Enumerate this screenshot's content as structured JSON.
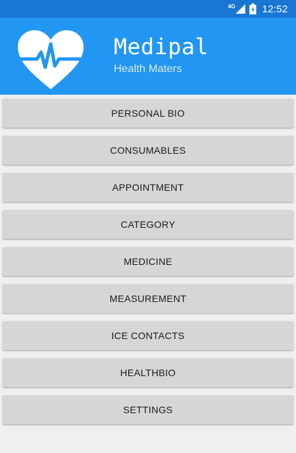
{
  "status_bar": {
    "network_label": "4G",
    "time": "12:52",
    "signal_icon": "signal-icon",
    "battery_icon": "battery-icon"
  },
  "header": {
    "title": "Medipal",
    "subtitle": "Health Maters",
    "logo_icon": "heart-pulse-icon",
    "background_color": "#2196f3",
    "status_bar_color": "#1976d2"
  },
  "menu": {
    "items": [
      {
        "label": "PERSONAL BIO"
      },
      {
        "label": "CONSUMABLES"
      },
      {
        "label": "APPOINTMENT"
      },
      {
        "label": "CATEGORY"
      },
      {
        "label": "MEDICINE"
      },
      {
        "label": "MEASUREMENT"
      },
      {
        "label": "ICE CONTACTS"
      },
      {
        "label": "HEALTHBIO"
      },
      {
        "label": "SETTINGS"
      }
    ]
  }
}
